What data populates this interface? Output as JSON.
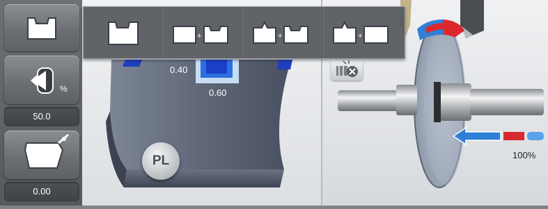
{
  "side_panel": {
    "profile_button_icon": "bevel-profile-icon",
    "position_button_icon": "bevel-position-icon",
    "position_unit": "%",
    "position_value": "50.0",
    "polish_button_icon": "edge-safety-bevel-icon",
    "polish_value": "0.00"
  },
  "bevel_popup": {
    "options": [
      {
        "icon": "groove-profile-icon"
      },
      {
        "icon": "flat-plus-groove-icon"
      },
      {
        "icon": "bevel-plus-groove-icon"
      },
      {
        "icon": "bevel-plus-flat-icon"
      }
    ]
  },
  "lens_view": {
    "groove_depth": "0.40",
    "groove_width": "0.60",
    "material_badge": "PL"
  },
  "wheel_view": {
    "tool_toggle_icon": "tool-disable-icon",
    "progress_label": "100%",
    "progress": 1.0,
    "accent_blue": "#2f7fd6",
    "accent_red": "#d9292f"
  }
}
